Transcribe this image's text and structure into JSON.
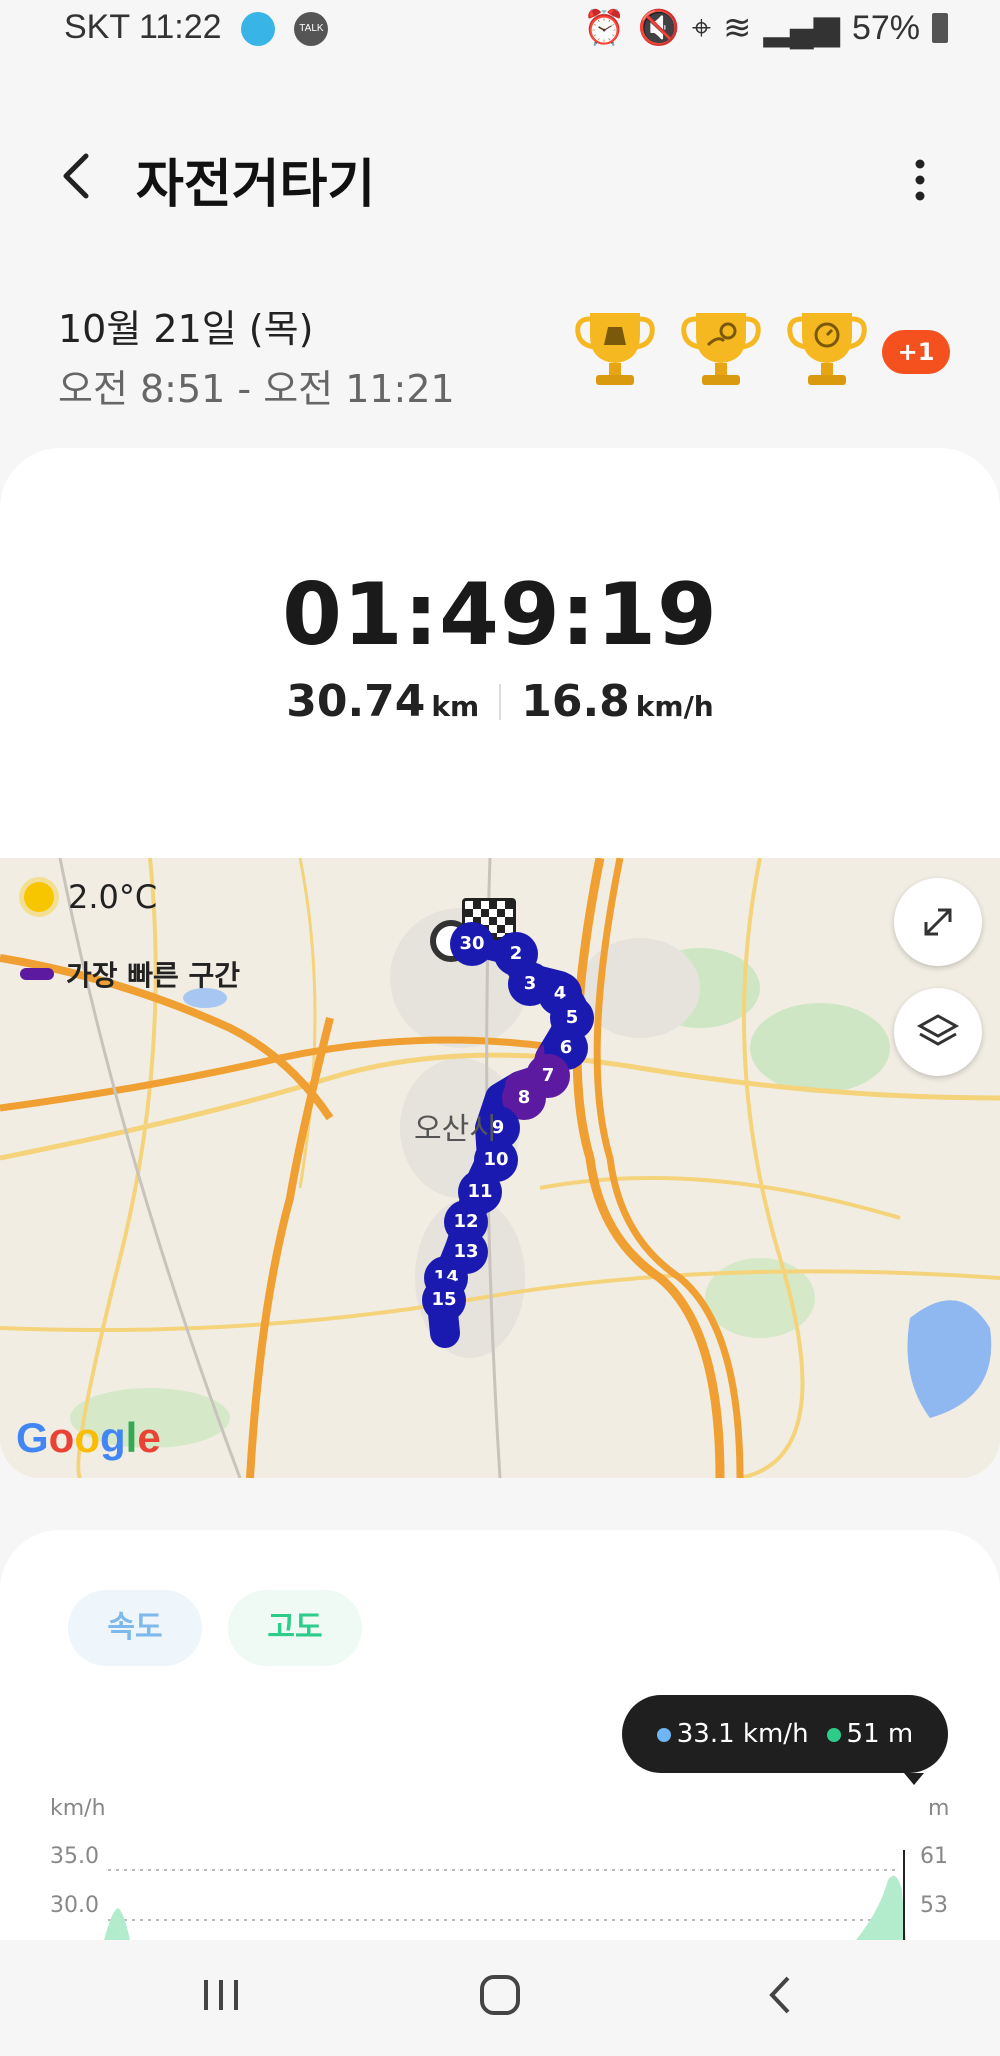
{
  "status_bar": {
    "carrier_time": "SKT 11:22",
    "talk_icon_text": "TALK",
    "battery": "57%"
  },
  "header": {
    "title": "자전거타기"
  },
  "session": {
    "date": "10월 21일 (목)",
    "time_range": "오전 8:51 - 오전 11:21",
    "extra_badge": "+1"
  },
  "summary": {
    "duration": "01:49:19",
    "distance_value": "30.74",
    "distance_unit": "km",
    "speed_value": "16.8",
    "speed_unit": "km/h"
  },
  "map": {
    "temperature": "2.0°C",
    "legend_label": "가장 빠른 구간",
    "city_label": "오산시",
    "markers": [
      "30",
      "2",
      "3",
      "4",
      "5",
      "6",
      "7",
      "8",
      "9",
      "10",
      "11",
      "12",
      "13",
      "14",
      "15"
    ],
    "google": "Google"
  },
  "chart": {
    "tabs": [
      "속도",
      "고도"
    ],
    "tooltip_speed": "33.1 km/h",
    "tooltip_altitude": "51 m",
    "left_unit": "km/h",
    "right_unit": "m",
    "left_ticks": [
      "35.0",
      "30.0"
    ],
    "right_ticks": [
      "61",
      "53"
    ]
  },
  "colors": {
    "accent_orange": "#f4511e",
    "route_blue": "#1a1ab0",
    "fastest_purple": "#5b1aa0",
    "speed_color": "#6fb6f4",
    "altitude_color": "#2ecc8a"
  }
}
